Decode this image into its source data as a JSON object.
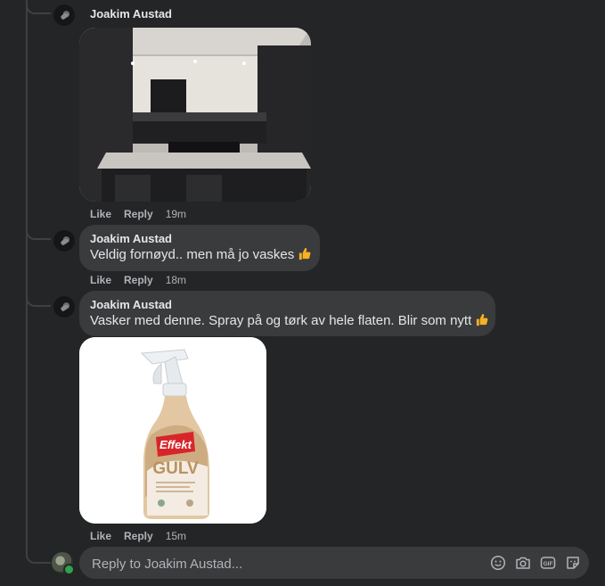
{
  "comments": [
    {
      "author": "Joakim Austad",
      "text": "",
      "actions": {
        "like": "Like",
        "reply": "Reply",
        "time": "19m"
      }
    },
    {
      "author": "Joakim Austad",
      "text": "Veldig fornøyd.. men må jo vaskes",
      "actions": {
        "like": "Like",
        "reply": "Reply",
        "time": "18m"
      }
    },
    {
      "author": "Joakim Austad",
      "text": "Vasker med denne. Spray på og tørk av hele flaten. Blir som nytt",
      "actions": {
        "like": "Like",
        "reply": "Reply",
        "time": "15m"
      }
    }
  ],
  "product": {
    "brand": "Effekt",
    "name": "GULV"
  },
  "reply": {
    "placeholder": "Reply to Joakim Austad..."
  },
  "icons": [
    "avatar",
    "thumbs-up-icon",
    "emoji-icon",
    "camera-icon",
    "gif-icon",
    "sticker-icon"
  ],
  "colors": {
    "background": "#242526",
    "bubble": "#3a3b3c",
    "text": "#e4e6eb",
    "secondary": "#b0b3b8",
    "thumb": "#f7b125",
    "online": "#31a24c"
  }
}
